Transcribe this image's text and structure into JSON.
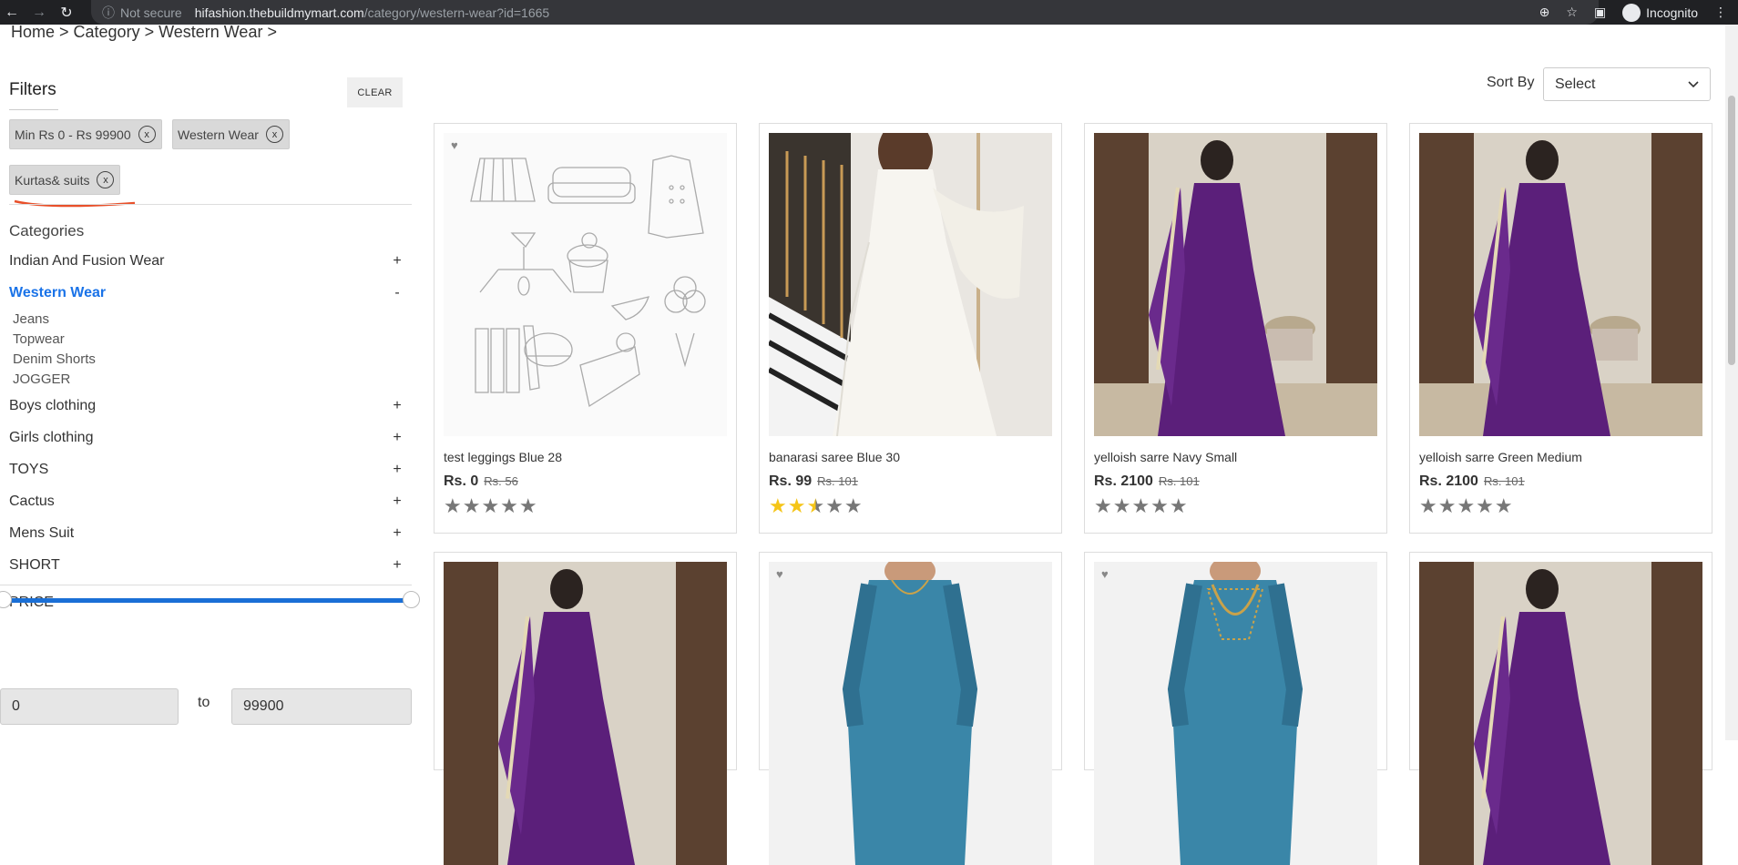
{
  "browser": {
    "security_label": "Not secure",
    "url_host": "hifashion.thebuildmymart.com",
    "url_path": "/category/western-wear?id=1665",
    "profile_label": "Incognito"
  },
  "breadcrumb": "Home > Category > Western Wear >",
  "filters": {
    "title": "Filters",
    "clear_label": "CLEAR",
    "chips": [
      {
        "label": "Min Rs 0 - Rs 99900",
        "remove": "x"
      },
      {
        "label": "Western Wear",
        "remove": "x"
      },
      {
        "label": "Kurtas& suits",
        "remove": "x"
      }
    ]
  },
  "categories": {
    "title": "Categories",
    "items": [
      {
        "label": "Indian And Fusion Wear",
        "sign": "+"
      },
      {
        "label": "Western Wear",
        "sign": "-"
      },
      {
        "label": "Boys clothing",
        "sign": "+"
      },
      {
        "label": "Girls clothing",
        "sign": "+"
      },
      {
        "label": "TOYS",
        "sign": "+"
      },
      {
        "label": "Cactus",
        "sign": "+"
      },
      {
        "label": "Mens Suit",
        "sign": "+"
      },
      {
        "label": "SHORT",
        "sign": "+"
      }
    ],
    "subitems": [
      "Jeans",
      "Topwear",
      "Denim Shorts",
      "JOGGER"
    ]
  },
  "price": {
    "title": "PRICE",
    "min": "0",
    "max": "99900",
    "to_label": "to"
  },
  "sort": {
    "label": "Sort By",
    "selected": "Select"
  },
  "products": [
    {
      "name": "test leggings Blue 28",
      "price": "Rs. 0",
      "mrp": "Rs. 56",
      "rating": 0
    },
    {
      "name": "banarasi saree Blue 30",
      "price": "Rs. 99",
      "mrp": "Rs. 101",
      "rating": 2.5
    },
    {
      "name": "yelloish sarre Navy Small",
      "price": "Rs. 2100",
      "mrp": "Rs. 101",
      "rating": 0
    },
    {
      "name": "yelloish sarre Green Medium",
      "price": "Rs. 2100",
      "mrp": "Rs. 101",
      "rating": 0
    }
  ],
  "colors": {
    "accent": "#1a73e8",
    "star_on": "#f5c518",
    "star_off": "#777777",
    "purple_dress": "#5b1f7a",
    "teal_kurta": "#3a86a8"
  }
}
